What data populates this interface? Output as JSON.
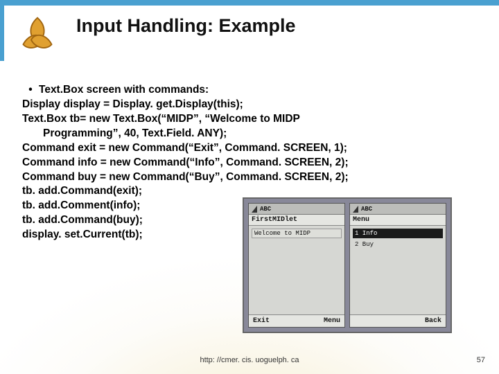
{
  "title": "Input Handling: Example",
  "bullet": "Text.Box screen with commands:",
  "code": {
    "l1": "Display display = Display. get.Display(this);",
    "l2": "Text.Box tb= new Text.Box(“MIDP”, “Welcome to MIDP",
    "l2b": "Programming”, 40, Text.Field. ANY);",
    "l3": "Command exit = new Command(“Exit”, Command. SCREEN, 1);",
    "l4": "Command info = new Command(“Info”, Command. SCREEN, 2);",
    "l5": "Command buy = new Command(“Buy”, Command. SCREEN, 2);",
    "l6": "tb. add.Command(exit);",
    "l7": "tb. add.Comment(info);",
    "l8": "tb. add.Command(buy);",
    "l9": "display. set.Current(tb);"
  },
  "phone_left": {
    "abc": "ABC",
    "header": "FirstMIDlet",
    "body_text": "Welcome to MIDP",
    "soft_left": "Exit",
    "soft_right": "Menu"
  },
  "phone_right": {
    "abc": "ABC",
    "header": "Menu",
    "item1": "1  Info",
    "item2": "2  Buy",
    "soft_left": "",
    "soft_right": "Back"
  },
  "footer_url": "http: //cmer. cis. uoguelph. ca",
  "page_number": "57",
  "colors": {
    "accent": "#4aa0d0",
    "logo_fill": "#e0a030",
    "logo_stroke": "#a06510"
  }
}
